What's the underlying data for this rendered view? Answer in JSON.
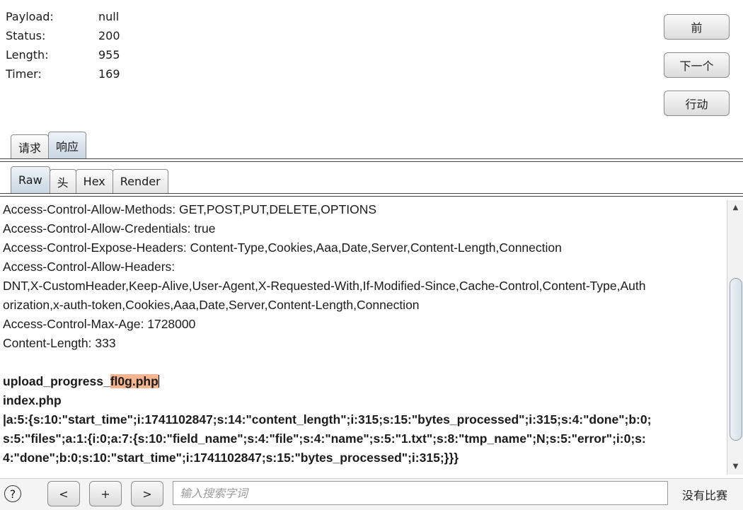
{
  "info": [
    {
      "label": "Payload:",
      "value": "null"
    },
    {
      "label": "Status:",
      "value": "200"
    },
    {
      "label": "Length:",
      "value": "955"
    },
    {
      "label": "Timer:",
      "value": "169"
    }
  ],
  "side_buttons": {
    "prev": "前",
    "next": "下一个",
    "action": "行动"
  },
  "tabs_main": {
    "request": "请求",
    "response": "响应"
  },
  "tabs_view": {
    "raw": "Raw",
    "headers": "头",
    "hex": "Hex",
    "render": "Render"
  },
  "response_lines": [
    "Access-Control-Allow-Methods: GET,POST,PUT,DELETE,OPTIONS",
    "Access-Control-Allow-Credentials: true",
    "Access-Control-Expose-Headers: Content-Type,Cookies,Aaa,Date,Server,Content-Length,Connection",
    "Access-Control-Allow-Headers:",
    "DNT,X-CustomHeader,Keep-Alive,User-Agent,X-Requested-With,If-Modified-Since,Cache-Control,Content-Type,Auth",
    "orization,x-auth-token,Cookies,Aaa,Date,Server,Content-Length,Connection",
    "Access-Control-Max-Age: 1728000",
    "Content-Length: 333"
  ],
  "body": {
    "line1_prefix": "upload_progress_",
    "line1_highlight": "fl0g.php",
    "line2": "index.php",
    "line3": "|a:5:{s:10:\"start_time\";i:1741102847;s:14:\"content_length\";i:315;s:15:\"bytes_processed\";i:315;s:4:\"done\";b:0;",
    "line4": "s:5:\"files\";a:1:{i:0;a:7:{s:10:\"field_name\";s:4:\"file\";s:4:\"name\";s:5:\"1.txt\";s:8:\"tmp_name\";N;s:5:\"error\";i:0;s:",
    "line5": "4:\"done\";b:0;s:10:\"start_time\";i:1741102847;s:15:\"bytes_processed\";i:315;}}}"
  },
  "bottom": {
    "help": "?",
    "prev": "<",
    "add": "+",
    "next": ">",
    "search_placeholder": "输入搜索字词",
    "match_status": "没有比赛"
  }
}
